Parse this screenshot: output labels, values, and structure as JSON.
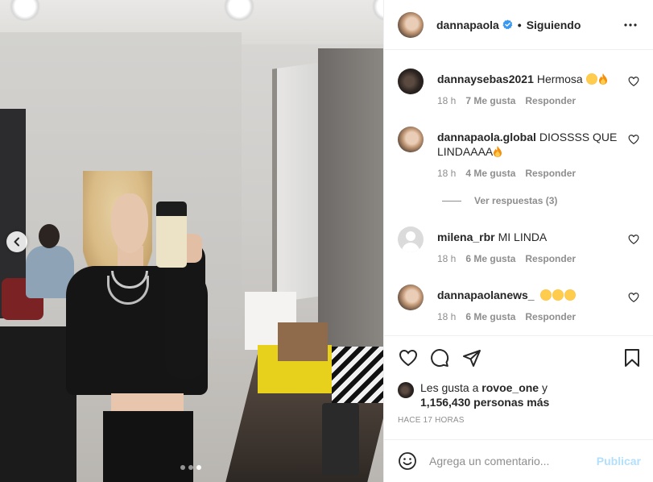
{
  "header": {
    "username": "dannapaola",
    "separator": "•",
    "follow_status": "Siguiendo"
  },
  "comments": [
    {
      "username": "dannaysebas2021",
      "text": "Hermosa",
      "emojis": [
        "heart-eyes",
        "fire"
      ],
      "time": "18 h",
      "likes": "7 Me gusta",
      "reply": "Responder"
    },
    {
      "username": "dannapaola.global",
      "text": "DIOSSSS QUE LINDAAAA",
      "emojis": [
        "fire"
      ],
      "time": "18 h",
      "likes": "4 Me gusta",
      "reply": "Responder",
      "view_replies": "Ver respuestas (3)"
    },
    {
      "username": "milena_rbr",
      "text": "MI LINDA",
      "emojis": [],
      "time": "18 h",
      "likes": "6 Me gusta",
      "reply": "Responder"
    },
    {
      "username": "dannapaolanews_",
      "text": "",
      "emojis": [
        "heart-eyes",
        "heart-eyes",
        "heart-eyes"
      ],
      "time": "18 h",
      "likes": "6 Me gusta",
      "reply": "Responder"
    }
  ],
  "likes": {
    "prefix": "Les gusta a",
    "user": "rovoe_one",
    "conjunction": "y",
    "count": "1,156,430 personas más"
  },
  "timestamp": "HACE 17 HORAS",
  "composer": {
    "placeholder": "Agrega un comentario...",
    "post_label": "Publicar"
  },
  "carousel": {
    "dots": 3,
    "active_dot": 3
  },
  "colors": {
    "verified": "#3897f0",
    "post_disabled": "#b2dffc",
    "muted": "#8e8e8e"
  }
}
